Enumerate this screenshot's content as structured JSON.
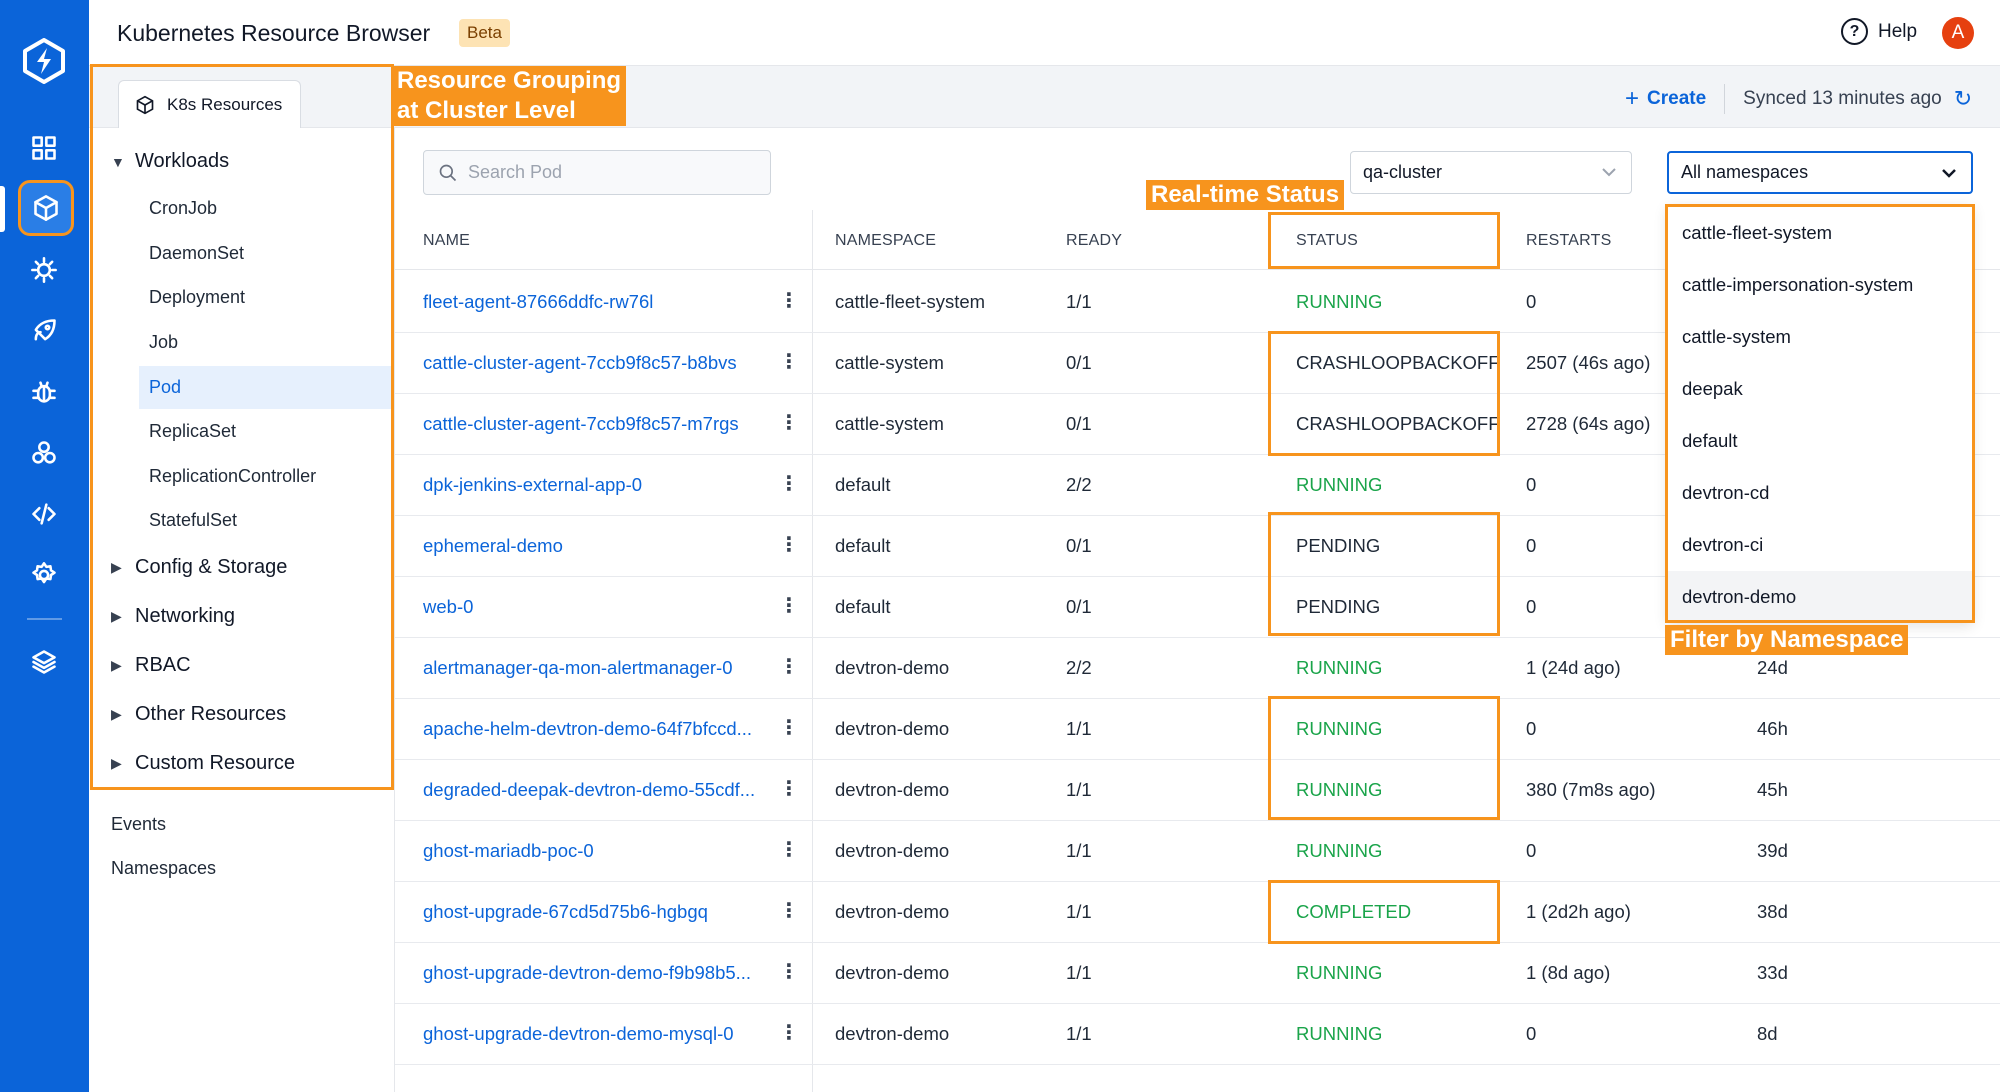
{
  "rail": {
    "icons": [
      "devtron-logo-icon",
      "grid-icon",
      "cube-icon",
      "bug-gear-icon",
      "rocket-icon",
      "bug-icon",
      "cluster-icon",
      "code-icon",
      "gear-icon",
      "stack-icon"
    ]
  },
  "header": {
    "title": "Kubernetes Resource Browser",
    "badge": "Beta",
    "help_label": "Help",
    "avatar_letter": "A"
  },
  "tab": {
    "label": "K8s Resources"
  },
  "toolbar": {
    "create_label": "Create",
    "synced_text": "Synced 13 minutes ago"
  },
  "sidebar": {
    "workloads_label": "Workloads",
    "workload_items": [
      "CronJob",
      "DaemonSet",
      "Deployment",
      "Job",
      "Pod",
      "ReplicaSet",
      "ReplicationController",
      "StatefulSet"
    ],
    "selected_item": "Pod",
    "groups": [
      "Config & Storage",
      "Networking",
      "RBAC",
      "Other Resources",
      "Custom Resource"
    ],
    "plain_items": [
      "Events",
      "Namespaces"
    ]
  },
  "search": {
    "placeholder": "Search Pod"
  },
  "cluster_select": {
    "value": "qa-cluster"
  },
  "namespace_select": {
    "value": "All namespaces",
    "options": [
      "cattle-fleet-system",
      "cattle-impersonation-system",
      "cattle-system",
      "deepak",
      "default",
      "devtron-cd",
      "devtron-ci",
      "devtron-demo"
    ]
  },
  "table": {
    "columns": [
      "NAME",
      "NAMESPACE",
      "READY",
      "STATUS",
      "RESTARTS"
    ],
    "rows": [
      {
        "name": "fleet-agent-87666ddfc-rw76l",
        "namespace": "cattle-fleet-system",
        "ready": "1/1",
        "status": "RUNNING",
        "restarts": "0",
        "age": ""
      },
      {
        "name": "cattle-cluster-agent-7ccb9f8c57-b8bvs",
        "namespace": "cattle-system",
        "ready": "0/1",
        "status": "CRASHLOOPBACKOFF",
        "restarts": "2507 (46s ago)",
        "age": ""
      },
      {
        "name": "cattle-cluster-agent-7ccb9f8c57-m7rgs",
        "namespace": "cattle-system",
        "ready": "0/1",
        "status": "CRASHLOOPBACKOFF",
        "restarts": "2728 (64s ago)",
        "age": ""
      },
      {
        "name": "dpk-jenkins-external-app-0",
        "namespace": "default",
        "ready": "2/2",
        "status": "RUNNING",
        "restarts": "0",
        "age": ""
      },
      {
        "name": "ephemeral-demo",
        "namespace": "default",
        "ready": "0/1",
        "status": "PENDING",
        "restarts": "0",
        "age": ""
      },
      {
        "name": "web-0",
        "namespace": "default",
        "ready": "0/1",
        "status": "PENDING",
        "restarts": "0",
        "age": ""
      },
      {
        "name": "alertmanager-qa-mon-alertmanager-0",
        "namespace": "devtron-demo",
        "ready": "2/2",
        "status": "RUNNING",
        "restarts": "1 (24d ago)",
        "age": "24d"
      },
      {
        "name": "apache-helm-devtron-demo-64f7bfccd...",
        "namespace": "devtron-demo",
        "ready": "1/1",
        "status": "RUNNING",
        "restarts": "0",
        "age": "46h"
      },
      {
        "name": "degraded-deepak-devtron-demo-55cdf...",
        "namespace": "devtron-demo",
        "ready": "1/1",
        "status": "RUNNING",
        "restarts": "380 (7m8s ago)",
        "age": "45h"
      },
      {
        "name": "ghost-mariadb-poc-0",
        "namespace": "devtron-demo",
        "ready": "1/1",
        "status": "RUNNING",
        "restarts": "0",
        "age": "39d"
      },
      {
        "name": "ghost-upgrade-67cd5d75b6-hgbgq",
        "namespace": "devtron-demo",
        "ready": "1/1",
        "status": "COMPLETED",
        "restarts": "1 (2d2h ago)",
        "age": "38d"
      },
      {
        "name": "ghost-upgrade-devtron-demo-f9b98b5...",
        "namespace": "devtron-demo",
        "ready": "1/1",
        "status": "RUNNING",
        "restarts": "1 (8d ago)",
        "age": "33d"
      },
      {
        "name": "ghost-upgrade-devtron-demo-mysql-0",
        "namespace": "devtron-demo",
        "ready": "1/1",
        "status": "RUNNING",
        "restarts": "0",
        "age": "8d"
      }
    ]
  },
  "annotations": {
    "grouping_line1": "Resource Grouping",
    "grouping_line2": "at Cluster Level",
    "realtime": "Real-time Status",
    "filter": "Filter by Namespace"
  },
  "colors": {
    "brand": "#0b64d9",
    "annotation": "#f7941d",
    "running": "#1aa44a",
    "beta_bg": "#fde3b4"
  }
}
